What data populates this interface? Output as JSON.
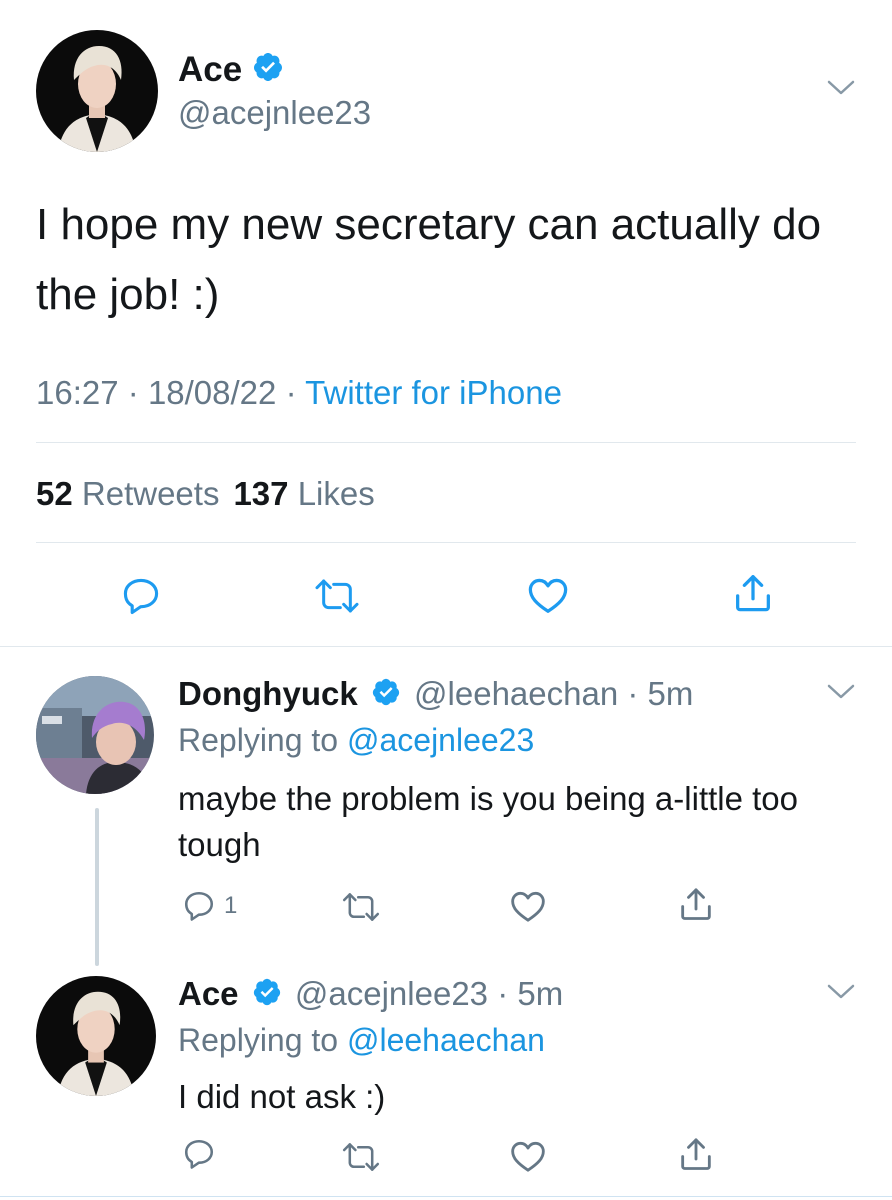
{
  "main_tweet": {
    "author_name": "Ace",
    "author_handle": "@acejnlee23",
    "text": "I hope my new secretary can actually do the job! :)",
    "time": "16:27",
    "date": "18/08/22",
    "separator": "·",
    "source": "Twitter for iPhone",
    "retweets_count": "52",
    "retweets_label": "Retweets",
    "likes_count": "137",
    "likes_label": "Likes"
  },
  "replies": [
    {
      "author_name": "Donghyuck",
      "author_handle": "@leehaechan",
      "separator": "·",
      "time_ago": "5m",
      "replying_prefix": "Replying to",
      "replying_to": "@acejnlee23",
      "text": "maybe the problem is you being a-little too tough",
      "reply_count": "1"
    },
    {
      "author_name": "Ace",
      "author_handle": "@acejnlee23",
      "separator": "·",
      "time_ago": "5m",
      "replying_prefix": "Replying to",
      "replying_to": "@leehaechan",
      "text": "I did not ask :)"
    }
  ],
  "colors": {
    "link_blue": "#1b95e0",
    "verified_blue": "#1da1f2",
    "muted_gray": "#657786",
    "text_dark": "#14171a",
    "divider": "#e1e8ed"
  },
  "icons": [
    "verified-badge-icon",
    "chevron-down-icon",
    "reply-icon",
    "retweet-icon",
    "like-icon",
    "share-icon"
  ]
}
